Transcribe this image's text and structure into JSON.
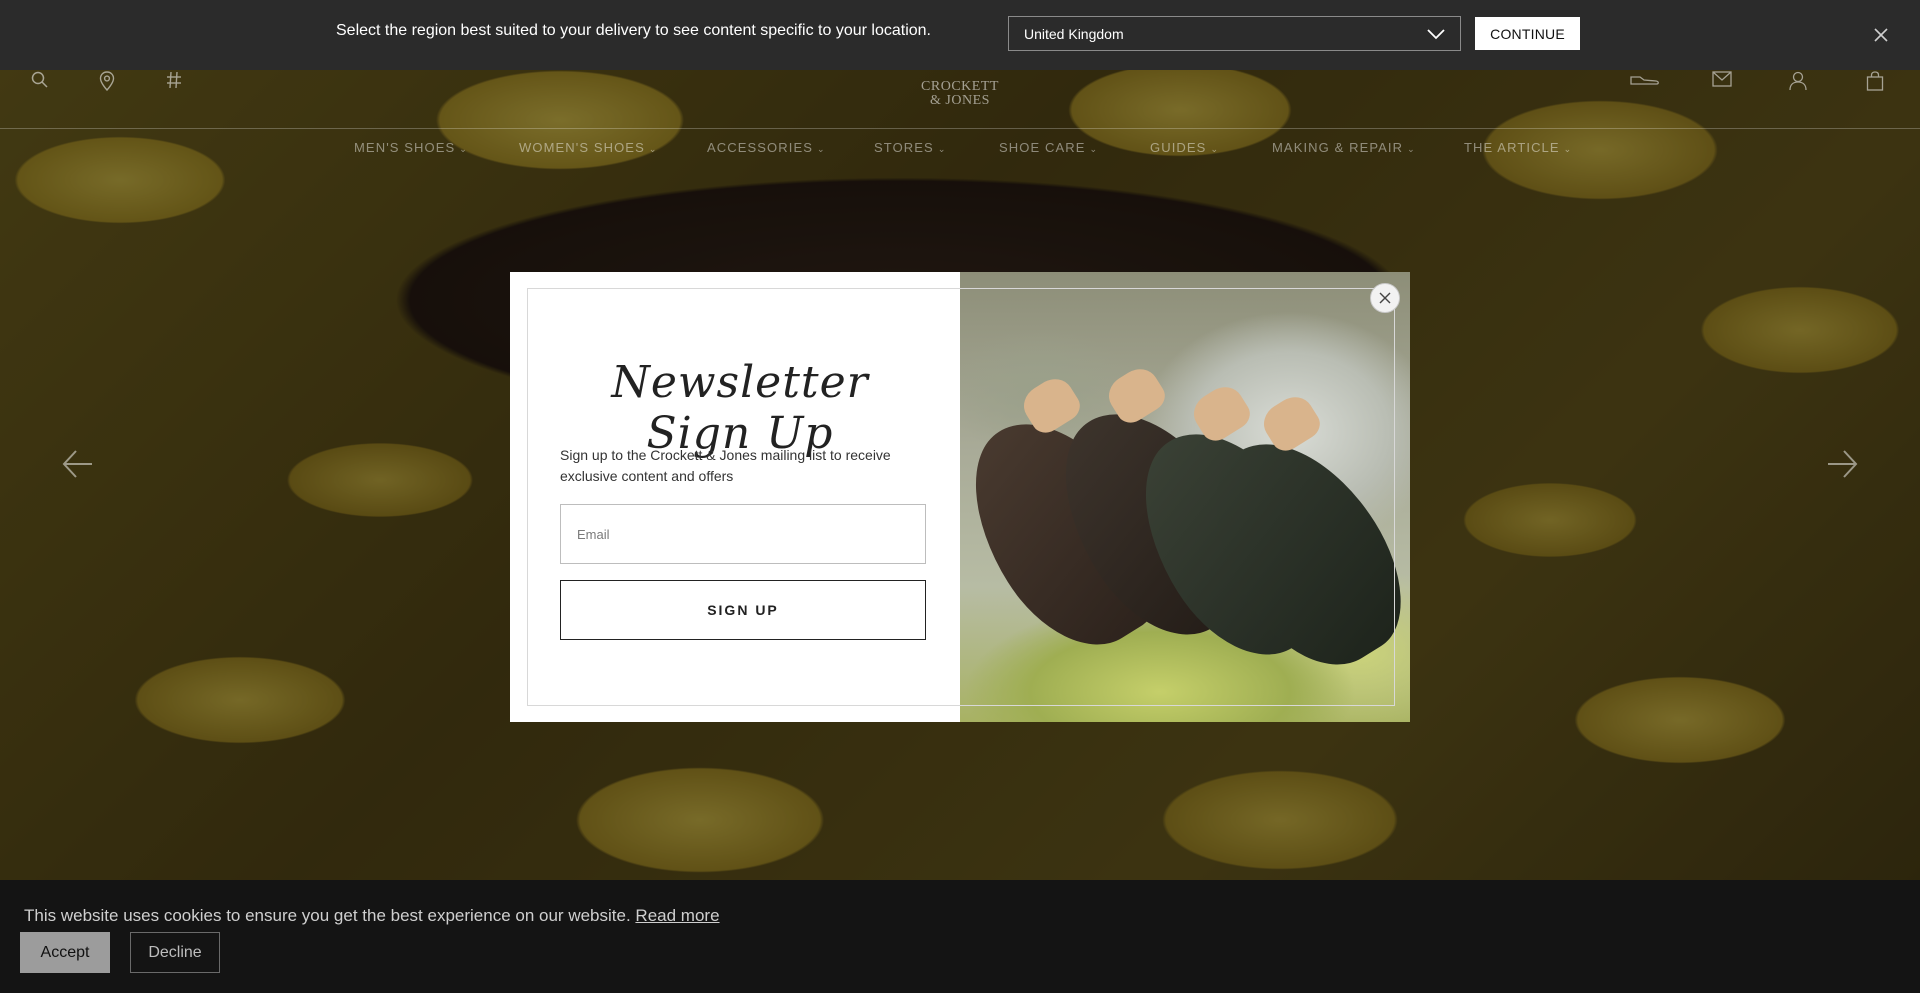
{
  "region_bar": {
    "message": "Select the region best suited to your delivery to see content specific to your location.",
    "selected_region": "United Kingdom",
    "continue_label": "CONTINUE"
  },
  "header": {
    "logo_line1": "CROCKETT",
    "logo_line2": "& JONES",
    "icons": [
      "search-icon",
      "location-icon",
      "hash-icon",
      "shoe-icon",
      "mail-icon",
      "account-icon",
      "bag-icon"
    ]
  },
  "nav": {
    "items": [
      {
        "label": "MEN'S SHOES"
      },
      {
        "label": "WOMEN'S SHOES"
      },
      {
        "label": "ACCESSORIES"
      },
      {
        "label": "STORES"
      },
      {
        "label": "SHOE CARE"
      },
      {
        "label": "GUIDES"
      },
      {
        "label": "MAKING & REPAIR"
      },
      {
        "label": "THE ARTICLE"
      }
    ]
  },
  "newsletter": {
    "title": "Newsletter Sign Up",
    "description": "Sign up to the Crockett & Jones mailing list to receive exclusive content and offers",
    "email_placeholder": "Email",
    "signup_label": "SIGN UP"
  },
  "cookie": {
    "message": "This website uses cookies to ensure you get the best experience on our website.",
    "read_more": "Read more",
    "accept_label": "Accept",
    "decline_label": "Decline"
  }
}
